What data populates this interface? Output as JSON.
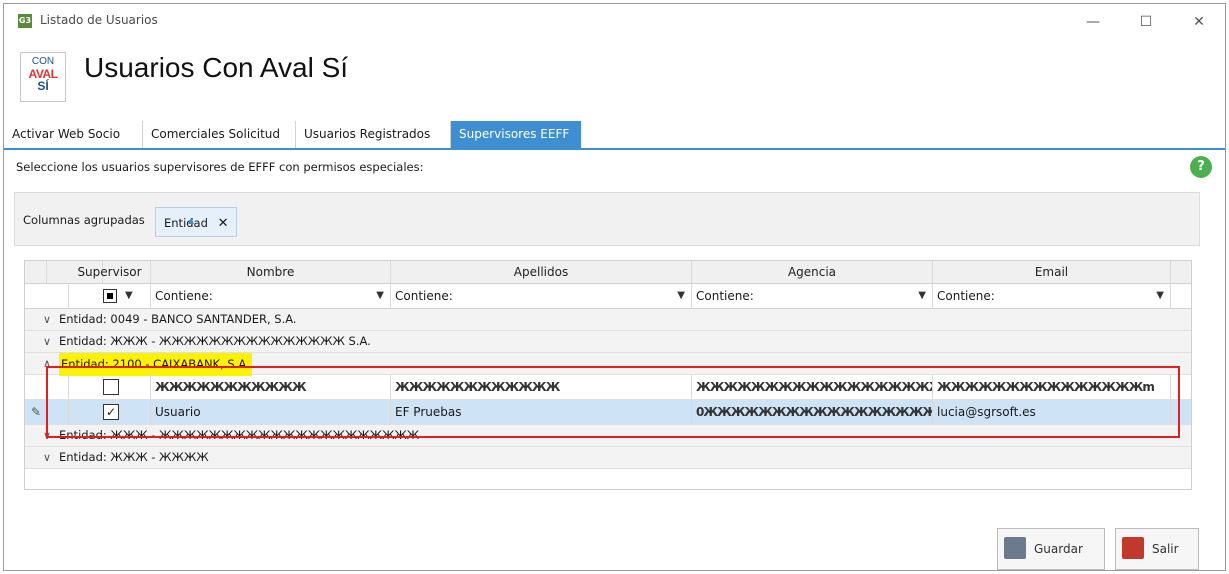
{
  "window": {
    "app_icon": "G3",
    "title": "Listado de Usuarios",
    "minimize": "—",
    "maximize": "☐",
    "close": "✕"
  },
  "header": {
    "logo": {
      "line1": "CON",
      "line2": "AVAL",
      "line3": "SÍ"
    },
    "title": "Usuarios Con Aval Sí"
  },
  "tabs": [
    {
      "label": "Activar Web Socio",
      "active": false
    },
    {
      "label": "Comerciales Solicitud",
      "active": false
    },
    {
      "label": "Usuarios Registrados",
      "active": false
    },
    {
      "label": "Supervisores EEFF",
      "active": true
    }
  ],
  "panel": {
    "instructions": "Seleccione los usuarios supervisores de EFFF con permisos especiales:",
    "help_icon": "help-icon",
    "group_label": "Columnas agrupadas",
    "group_chip": "Entidad"
  },
  "grid": {
    "columns": [
      "Supervisor",
      "Nombre",
      "Apellidos",
      "Agencia",
      "Email"
    ],
    "filter_placeholder": "Contiene:",
    "groups": [
      {
        "label": "Entidad: 0049 - BANCO SANTANDER, S.A.",
        "expanded": false
      },
      {
        "label": "Entidad: ЖЖЖ - ЖЖЖЖЖЖЖЖЖЖЖЖЖЖЖ S.A.",
        "expanded": false
      },
      {
        "label": "Entidad: 2100 - CAIXABANK, S.A.",
        "expanded": true,
        "highlighted": true
      },
      {
        "label": "Entidad: ЖЖЖ - ЖЖЖЖЖЖЖЖЖЖЖЖЖЖЖЖЖЖЖЖЖ",
        "expanded": false
      },
      {
        "label": "Entidad: ЖЖЖ - ЖЖЖЖ",
        "expanded": false
      }
    ],
    "rows": [
      {
        "supervisor": false,
        "nombre": "ЖЖЖЖЖЖЖЖЖЖЖ",
        "apellidos": "ЖЖЖЖЖЖЖЖЖЖЖЖ",
        "agencia": "ЖЖЖЖЖЖЖЖЖЖЖЖЖЖЖЖЖЖЖЖ",
        "email": "ЖЖЖЖЖЖЖЖЖЖЖЖЖЖЖm"
      },
      {
        "supervisor": true,
        "nombre": "Usuario",
        "apellidos": "EF Pruebas",
        "agencia": "0ЖЖЖЖЖЖЖЖЖЖЖЖЖЖЖЖЖЖ",
        "email": "lucia@sgrsoft.es"
      }
    ]
  },
  "buttons": {
    "save": "Guardar",
    "exit": "Salir"
  }
}
